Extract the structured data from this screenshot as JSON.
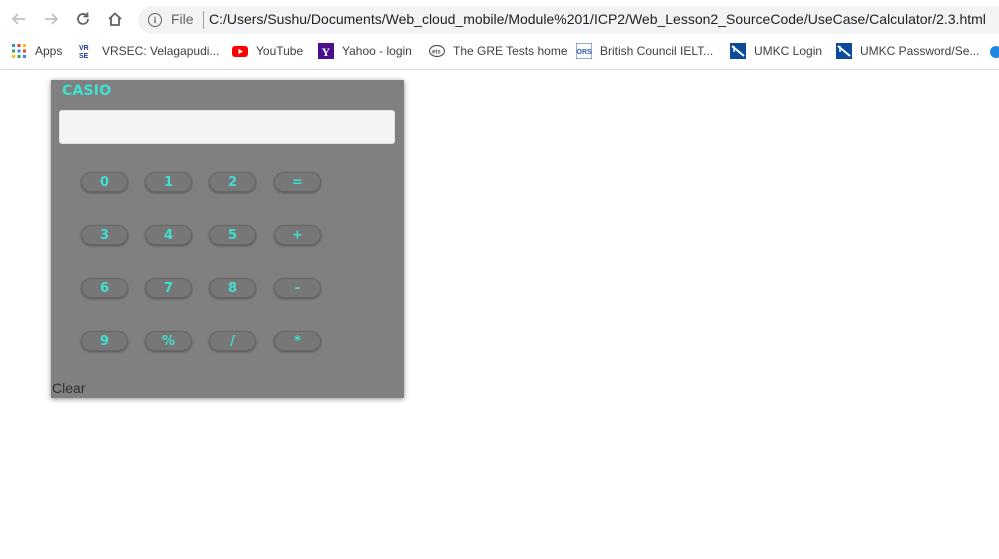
{
  "browser": {
    "scheme_label": "File",
    "url": "C:/Users/Sushu/Documents/Web_cloud_mobile/Module%201/ICP2/Web_Lesson2_SourceCode/UseCase/Calculator/2.3.html"
  },
  "bookmarks": [
    {
      "label": "Apps",
      "icon": "apps-grid-icon"
    },
    {
      "label": "VRSEC: Velagapudi...",
      "icon": "vrsec-icon"
    },
    {
      "label": "YouTube",
      "icon": "youtube-icon"
    },
    {
      "label": "Yahoo - login",
      "icon": "yahoo-icon"
    },
    {
      "label": "The GRE Tests home",
      "icon": "ets-icon"
    },
    {
      "label": "British Council IELT...",
      "icon": "british-council-icon"
    },
    {
      "label": "UMKC Login",
      "icon": "umkc-icon"
    },
    {
      "label": "UMKC Password/Se...",
      "icon": "umkc-icon"
    }
  ],
  "calculator": {
    "brand": "CASIO",
    "display_value": "",
    "keys": [
      [
        "0",
        "1",
        "2",
        "="
      ],
      [
        "3",
        "4",
        "5",
        "+"
      ],
      [
        "6",
        "7",
        "8",
        "-"
      ],
      [
        "9",
        "%",
        "/",
        "*"
      ]
    ],
    "clear_label": "Clear"
  },
  "colors": {
    "calculator_body": "#808080",
    "key_text": "#40e0d0",
    "brand_text": "#40e0d0"
  }
}
